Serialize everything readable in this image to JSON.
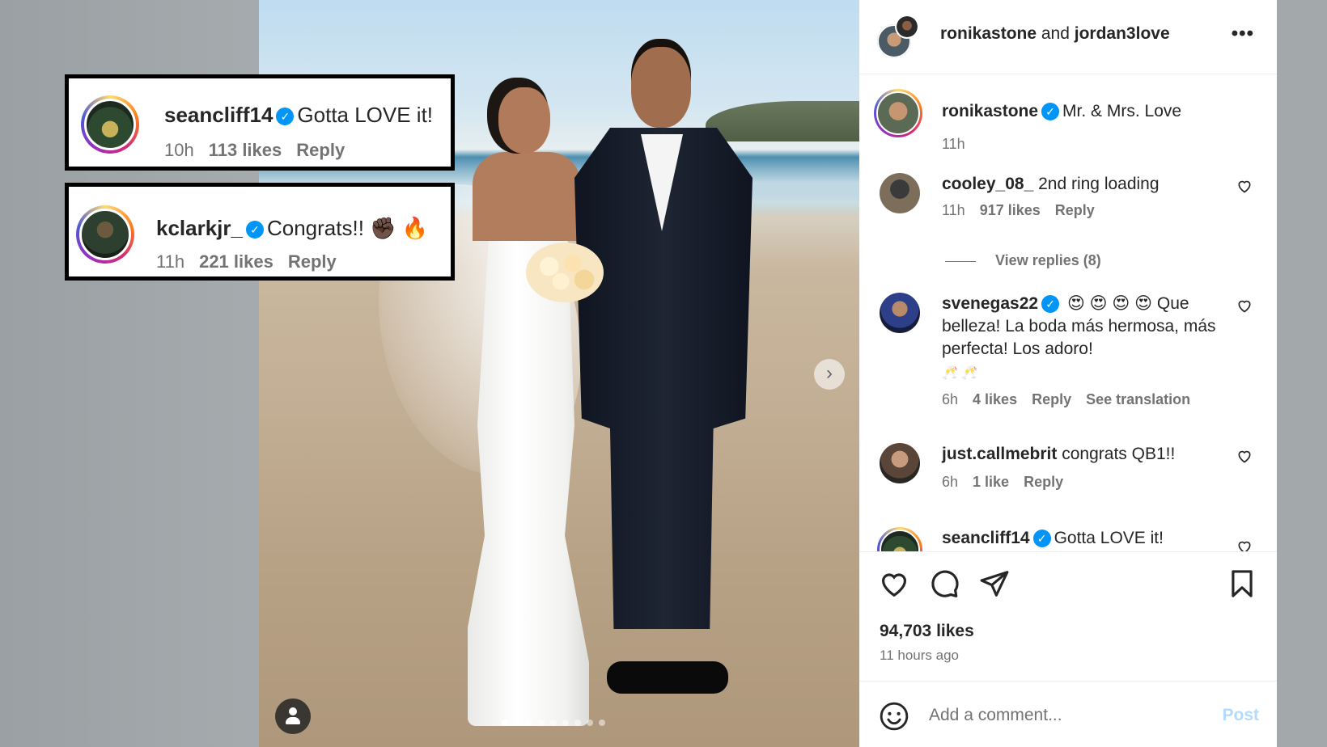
{
  "post": {
    "author": "ronikastone",
    "conjunction": "and",
    "collaborator": "jordan3love",
    "likes": "94,703 likes",
    "time_ago": "11 hours ago",
    "add_comment_placeholder": "Add a comment...",
    "post_button": "Post",
    "carousel_count": 9,
    "carousel_active": 1
  },
  "caption": {
    "user": "ronikastone",
    "text": "Mr. & Mrs. Love",
    "time": "11h"
  },
  "comments": [
    {
      "user": "cooley_08_",
      "text": "2nd ring loading",
      "time": "11h",
      "likes": "917 likes",
      "reply": "Reply",
      "view_replies": "View replies (8)"
    },
    {
      "user": "svenegas22",
      "emoji": "😍 😍 😍 😍",
      "text": "Que belleza! La boda más hermosa, más perfecta! Los adoro!",
      "emoji2": "🥂 🥂",
      "time": "6h",
      "likes": "4 likes",
      "reply": "Reply",
      "translate": "See translation"
    },
    {
      "user": "just.callmebrit",
      "text": "congrats QB1!!",
      "time": "6h",
      "likes": "1 like",
      "reply": "Reply"
    },
    {
      "user": "seancliff14",
      "text": "Gotta LOVE it!"
    }
  ],
  "callouts": [
    {
      "user": "seancliff14",
      "text": "Gotta LOVE it!",
      "time": "10h",
      "likes": "113 likes",
      "reply": "Reply"
    },
    {
      "user": "kclarkjr_",
      "text": "Congrats!! ✊🏿 🔥",
      "time": "11h",
      "likes": "221 likes",
      "reply": "Reply"
    }
  ],
  "icons": {
    "more": "more-options-icon",
    "like": "heart-icon",
    "comment": "comment-icon",
    "share": "share-icon",
    "save": "bookmark-icon",
    "emoji": "emoji-icon",
    "verified": "verified-badge-icon"
  },
  "colors": {
    "verified": "#0095f6",
    "post_button": "#b3dbff",
    "meta_text": "#737373"
  }
}
